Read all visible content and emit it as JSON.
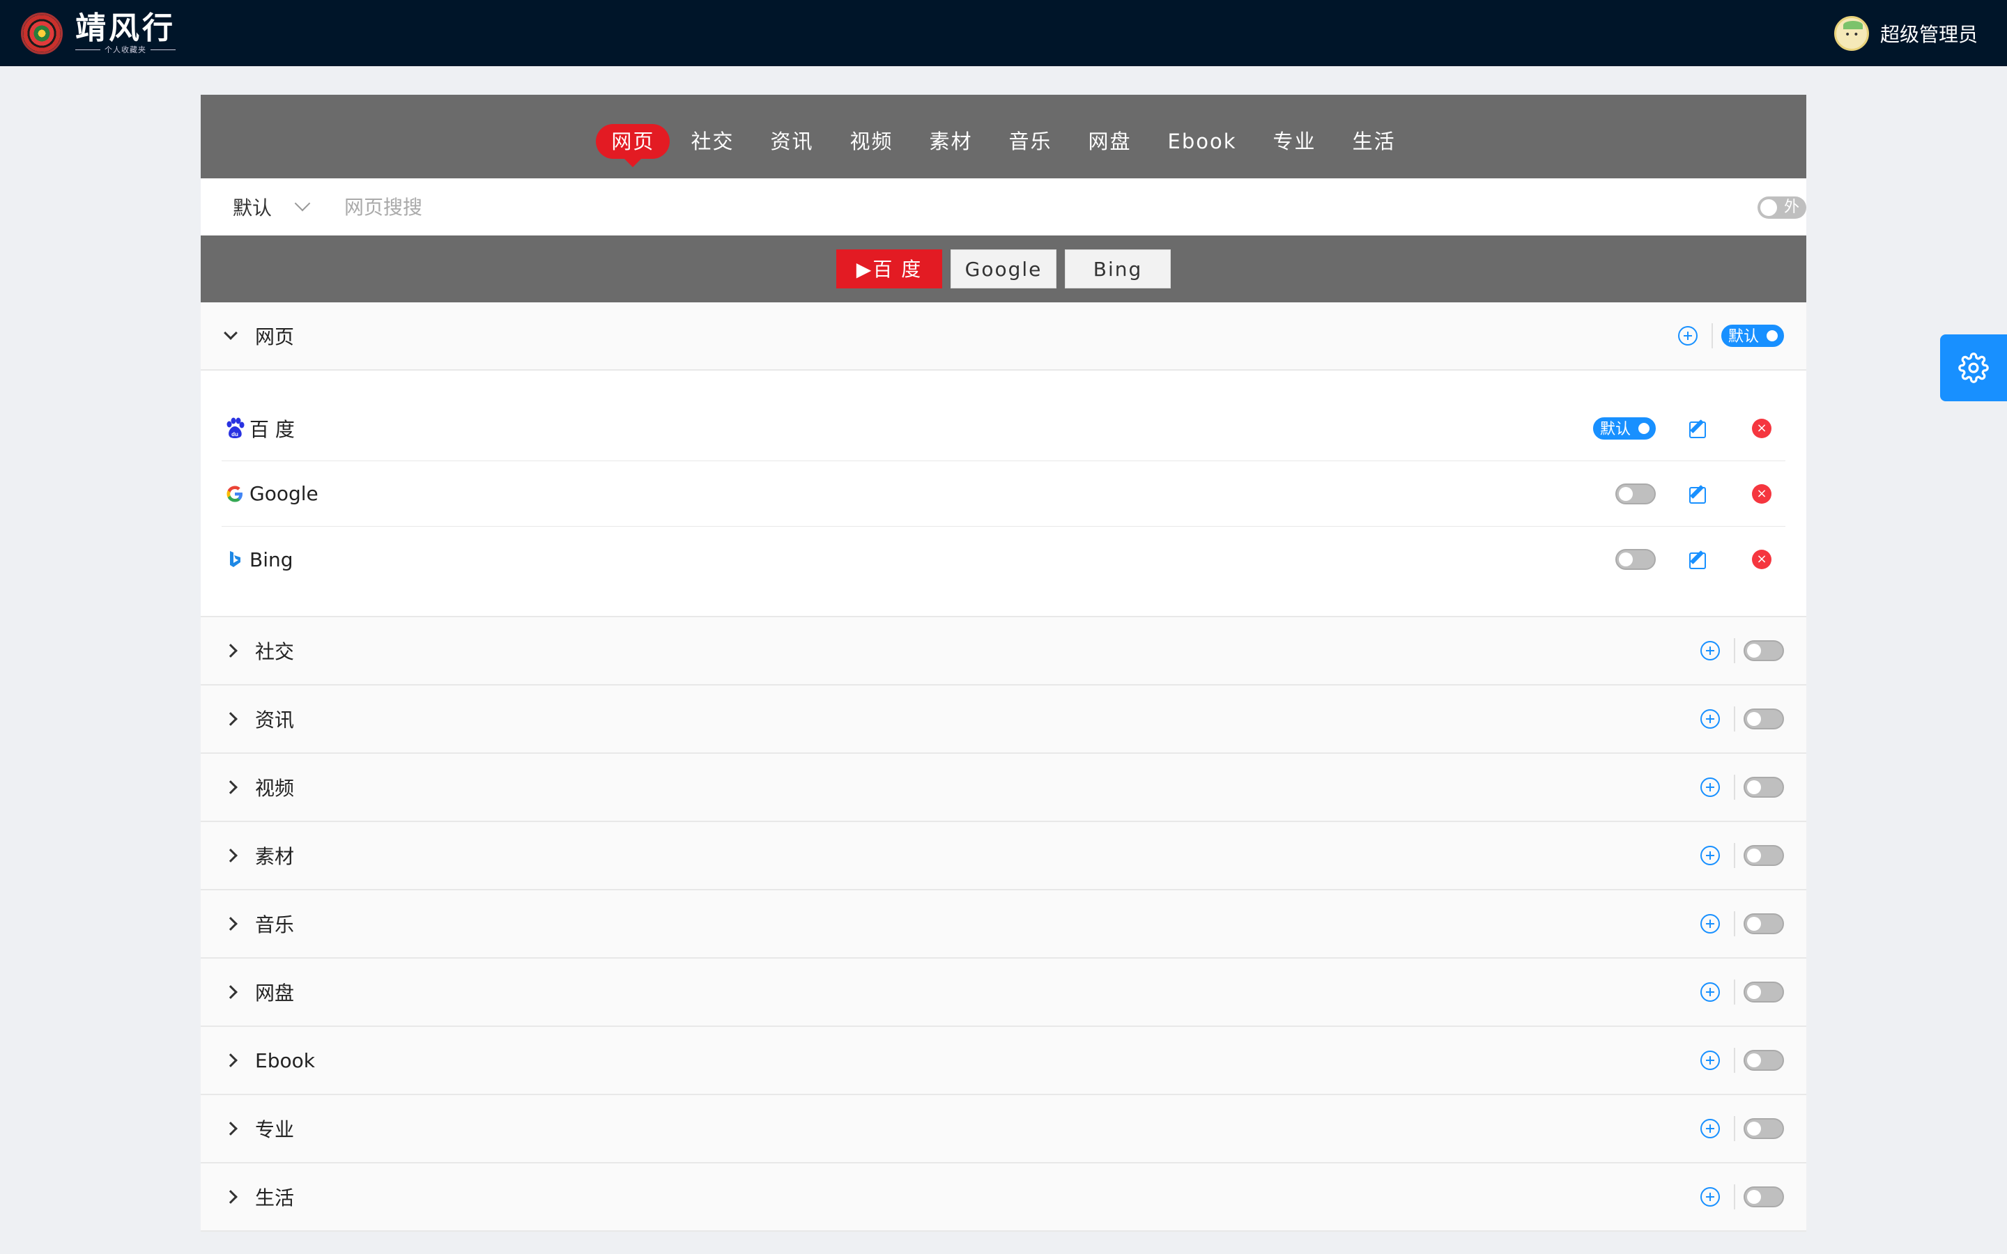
{
  "header": {
    "brand_name": "靖风行",
    "brand_sub": "个人收藏夹",
    "user_name": "超级管理员"
  },
  "tabs": [
    "网页",
    "社交",
    "资讯",
    "视频",
    "素材",
    "音乐",
    "网盘",
    "Ebook",
    "专业",
    "生活"
  ],
  "active_tab": "网页",
  "search": {
    "engine_selected": "默认",
    "placeholder": "网页搜搜",
    "outer_toggle_label": "外"
  },
  "engine_buttons": [
    "▶百 度",
    "Google",
    "Bing"
  ],
  "groups": [
    {
      "title": "网页",
      "expanded": true,
      "default_label": "默认",
      "engines": [
        {
          "name": "百 度",
          "icon": "baidu-paw-icon",
          "default": true,
          "default_label": "默认"
        },
        {
          "name": "Google",
          "icon": "google-icon",
          "default": false
        },
        {
          "name": "Bing",
          "icon": "bing-icon",
          "default": false
        }
      ]
    },
    {
      "title": "社交",
      "expanded": false
    },
    {
      "title": "资讯",
      "expanded": false
    },
    {
      "title": "视频",
      "expanded": false
    },
    {
      "title": "素材",
      "expanded": false
    },
    {
      "title": "音乐",
      "expanded": false
    },
    {
      "title": "网盘",
      "expanded": false
    },
    {
      "title": "Ebook",
      "expanded": false
    },
    {
      "title": "专业",
      "expanded": false
    },
    {
      "title": "生活",
      "expanded": false
    }
  ],
  "colors": {
    "header_bg": "#001529",
    "panel_gray": "#6b6b6b",
    "accent_red": "#e31b23",
    "accent_blue": "#1890ff",
    "delete_red": "#f5363f"
  }
}
